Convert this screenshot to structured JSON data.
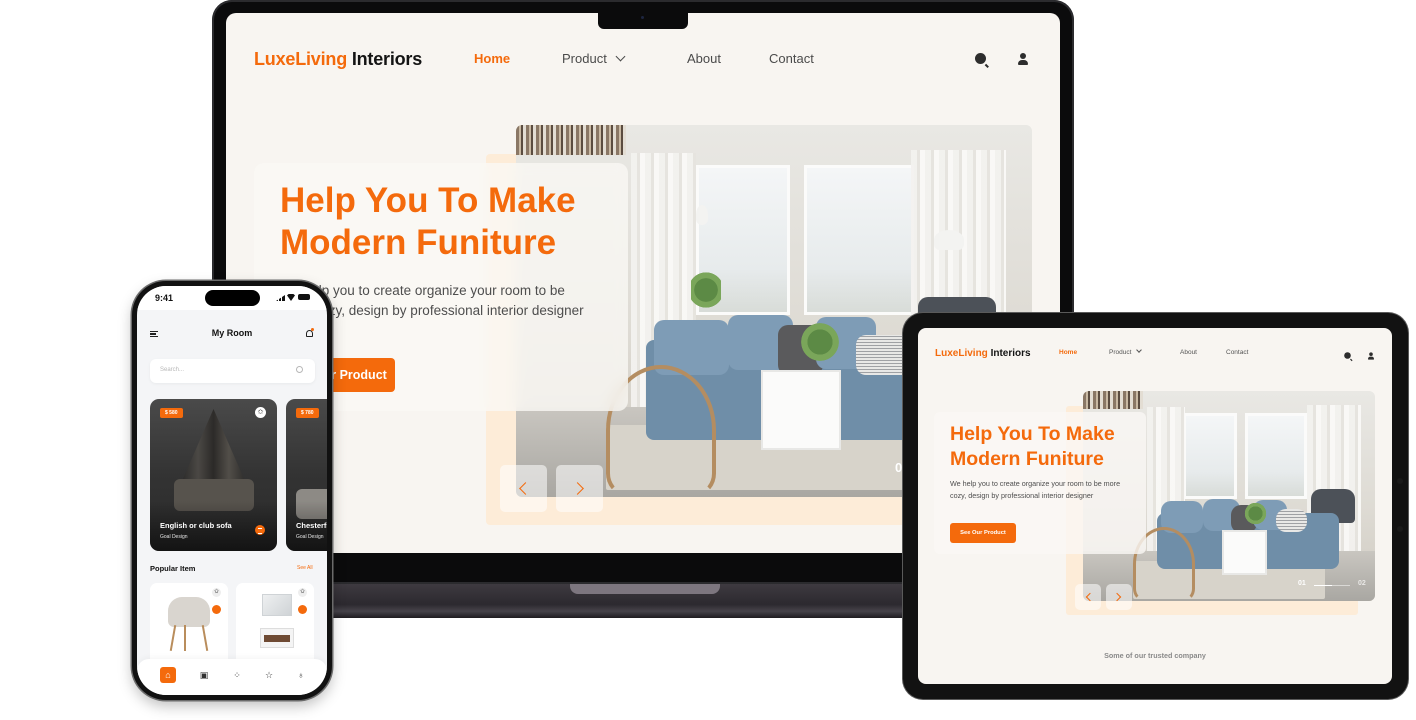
{
  "brand": {
    "part1": "LuxeLiving",
    "part2": "Interiors",
    "accent_color": "#f46a0c",
    "accent_light": "#fdecd8",
    "page_bg": "#f8f5f1"
  },
  "nav": {
    "items": [
      {
        "label": "Home",
        "active": true
      },
      {
        "label": "Product",
        "has_dropdown": true
      },
      {
        "label": "About"
      },
      {
        "label": "Contact"
      }
    ],
    "icons": [
      "search-icon",
      "user-icon"
    ]
  },
  "hero": {
    "headline_line1": "Help You To Make",
    "headline_line2": "Modern Funiture",
    "description": "We help you to create organize your room to be more cozy, design by professional interior designer",
    "laptop_visible_description": "p you to create organize your room to be zy, design by professional interior r.",
    "cta_label": "See Our Product",
    "laptop_visible_cta": "r Product",
    "prev_icon": "chevron-left-icon",
    "next_icon": "chevron-right-icon",
    "slide_current": "01",
    "slide_total": "02",
    "laptop_visible_slide": "0",
    "slide_progress": 0.5
  },
  "tablet_footer": {
    "trusted_label": "Some of our trusted company"
  },
  "phone": {
    "status_time": "9:41",
    "title": "My Room",
    "search_placeholder": "Search...",
    "featured": [
      {
        "price": "$ 580",
        "name": "English or club sofa",
        "subtitle": "Goal Design"
      },
      {
        "price": "$ 780",
        "name": "Chesterfield",
        "subtitle": "Goal Design",
        "visible_name": "Chesterf"
      }
    ],
    "section_title": "Popular Item",
    "see_all": "See All",
    "popular": [
      {
        "name": "Armchair",
        "icon": "chair-image"
      },
      {
        "name": "Vanity",
        "icon": "vanity-image"
      }
    ],
    "tabs": [
      {
        "name": "home",
        "icon": "⌂",
        "active": true
      },
      {
        "name": "calendar",
        "icon": "▣"
      },
      {
        "name": "grid",
        "icon": "⁘"
      },
      {
        "name": "favorites",
        "icon": "☆"
      },
      {
        "name": "profile",
        "icon": "♁"
      }
    ],
    "star_glyph": "✩"
  }
}
